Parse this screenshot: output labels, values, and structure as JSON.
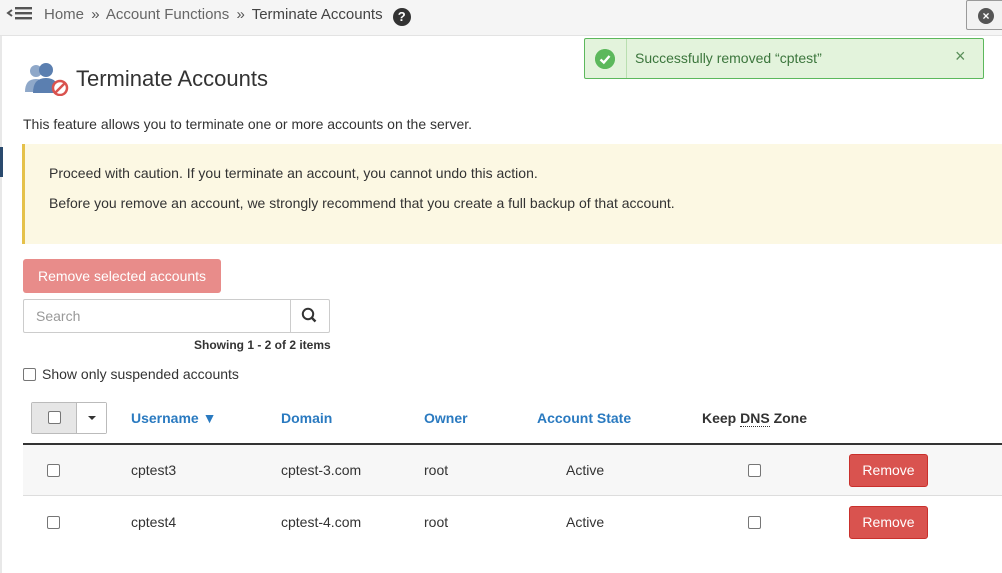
{
  "breadcrumb": {
    "items": [
      "Home",
      "Account Functions"
    ],
    "separator": "»",
    "current": "Terminate Accounts",
    "help_glyph": "?"
  },
  "toast": {
    "message": "Successfully removed “cptest”",
    "close_glyph": "×",
    "color": "#5cb85c"
  },
  "page": {
    "title": "Terminate Accounts",
    "intro": "This feature allows you to terminate one or more accounts on the server."
  },
  "caution": {
    "line1": "Proceed with caution. If you terminate an account, you cannot undo this action.",
    "line2": "Before you remove an account, we strongly recommend that you create a full backup of that account."
  },
  "actions": {
    "remove_selected_label": "Remove selected accounts",
    "search_placeholder": "Search",
    "showing_text": "Showing 1 - 2 of 2 items",
    "suspended_label": "Show only suspended accounts"
  },
  "table": {
    "headers": {
      "username": "Username ▼",
      "domain": "Domain",
      "owner": "Owner",
      "state": "Account State",
      "keep_prefix": "Keep ",
      "keep_abbr": "DNS",
      "keep_suffix": " Zone"
    },
    "rows": [
      {
        "username": "cptest3",
        "domain": "cptest-3.com",
        "owner": "root",
        "state": "Active",
        "remove_label": "Remove"
      },
      {
        "username": "cptest4",
        "domain": "cptest-4.com",
        "owner": "root",
        "state": "Active",
        "remove_label": "Remove"
      }
    ]
  },
  "colors": {
    "link": "#2a7ac0",
    "danger": "#d9534f",
    "danger_disabled": "#e88c8a",
    "warning_bg": "#fcf8e3",
    "success_bg": "#e3f3dc"
  },
  "icons": {
    "nav": "hamburger-collapse-icon",
    "help": "question-circle-icon",
    "close_panel": "close-circle-icon",
    "toast": "check-circle-icon",
    "page": "users-remove-icon",
    "search": "magnifier-icon"
  }
}
